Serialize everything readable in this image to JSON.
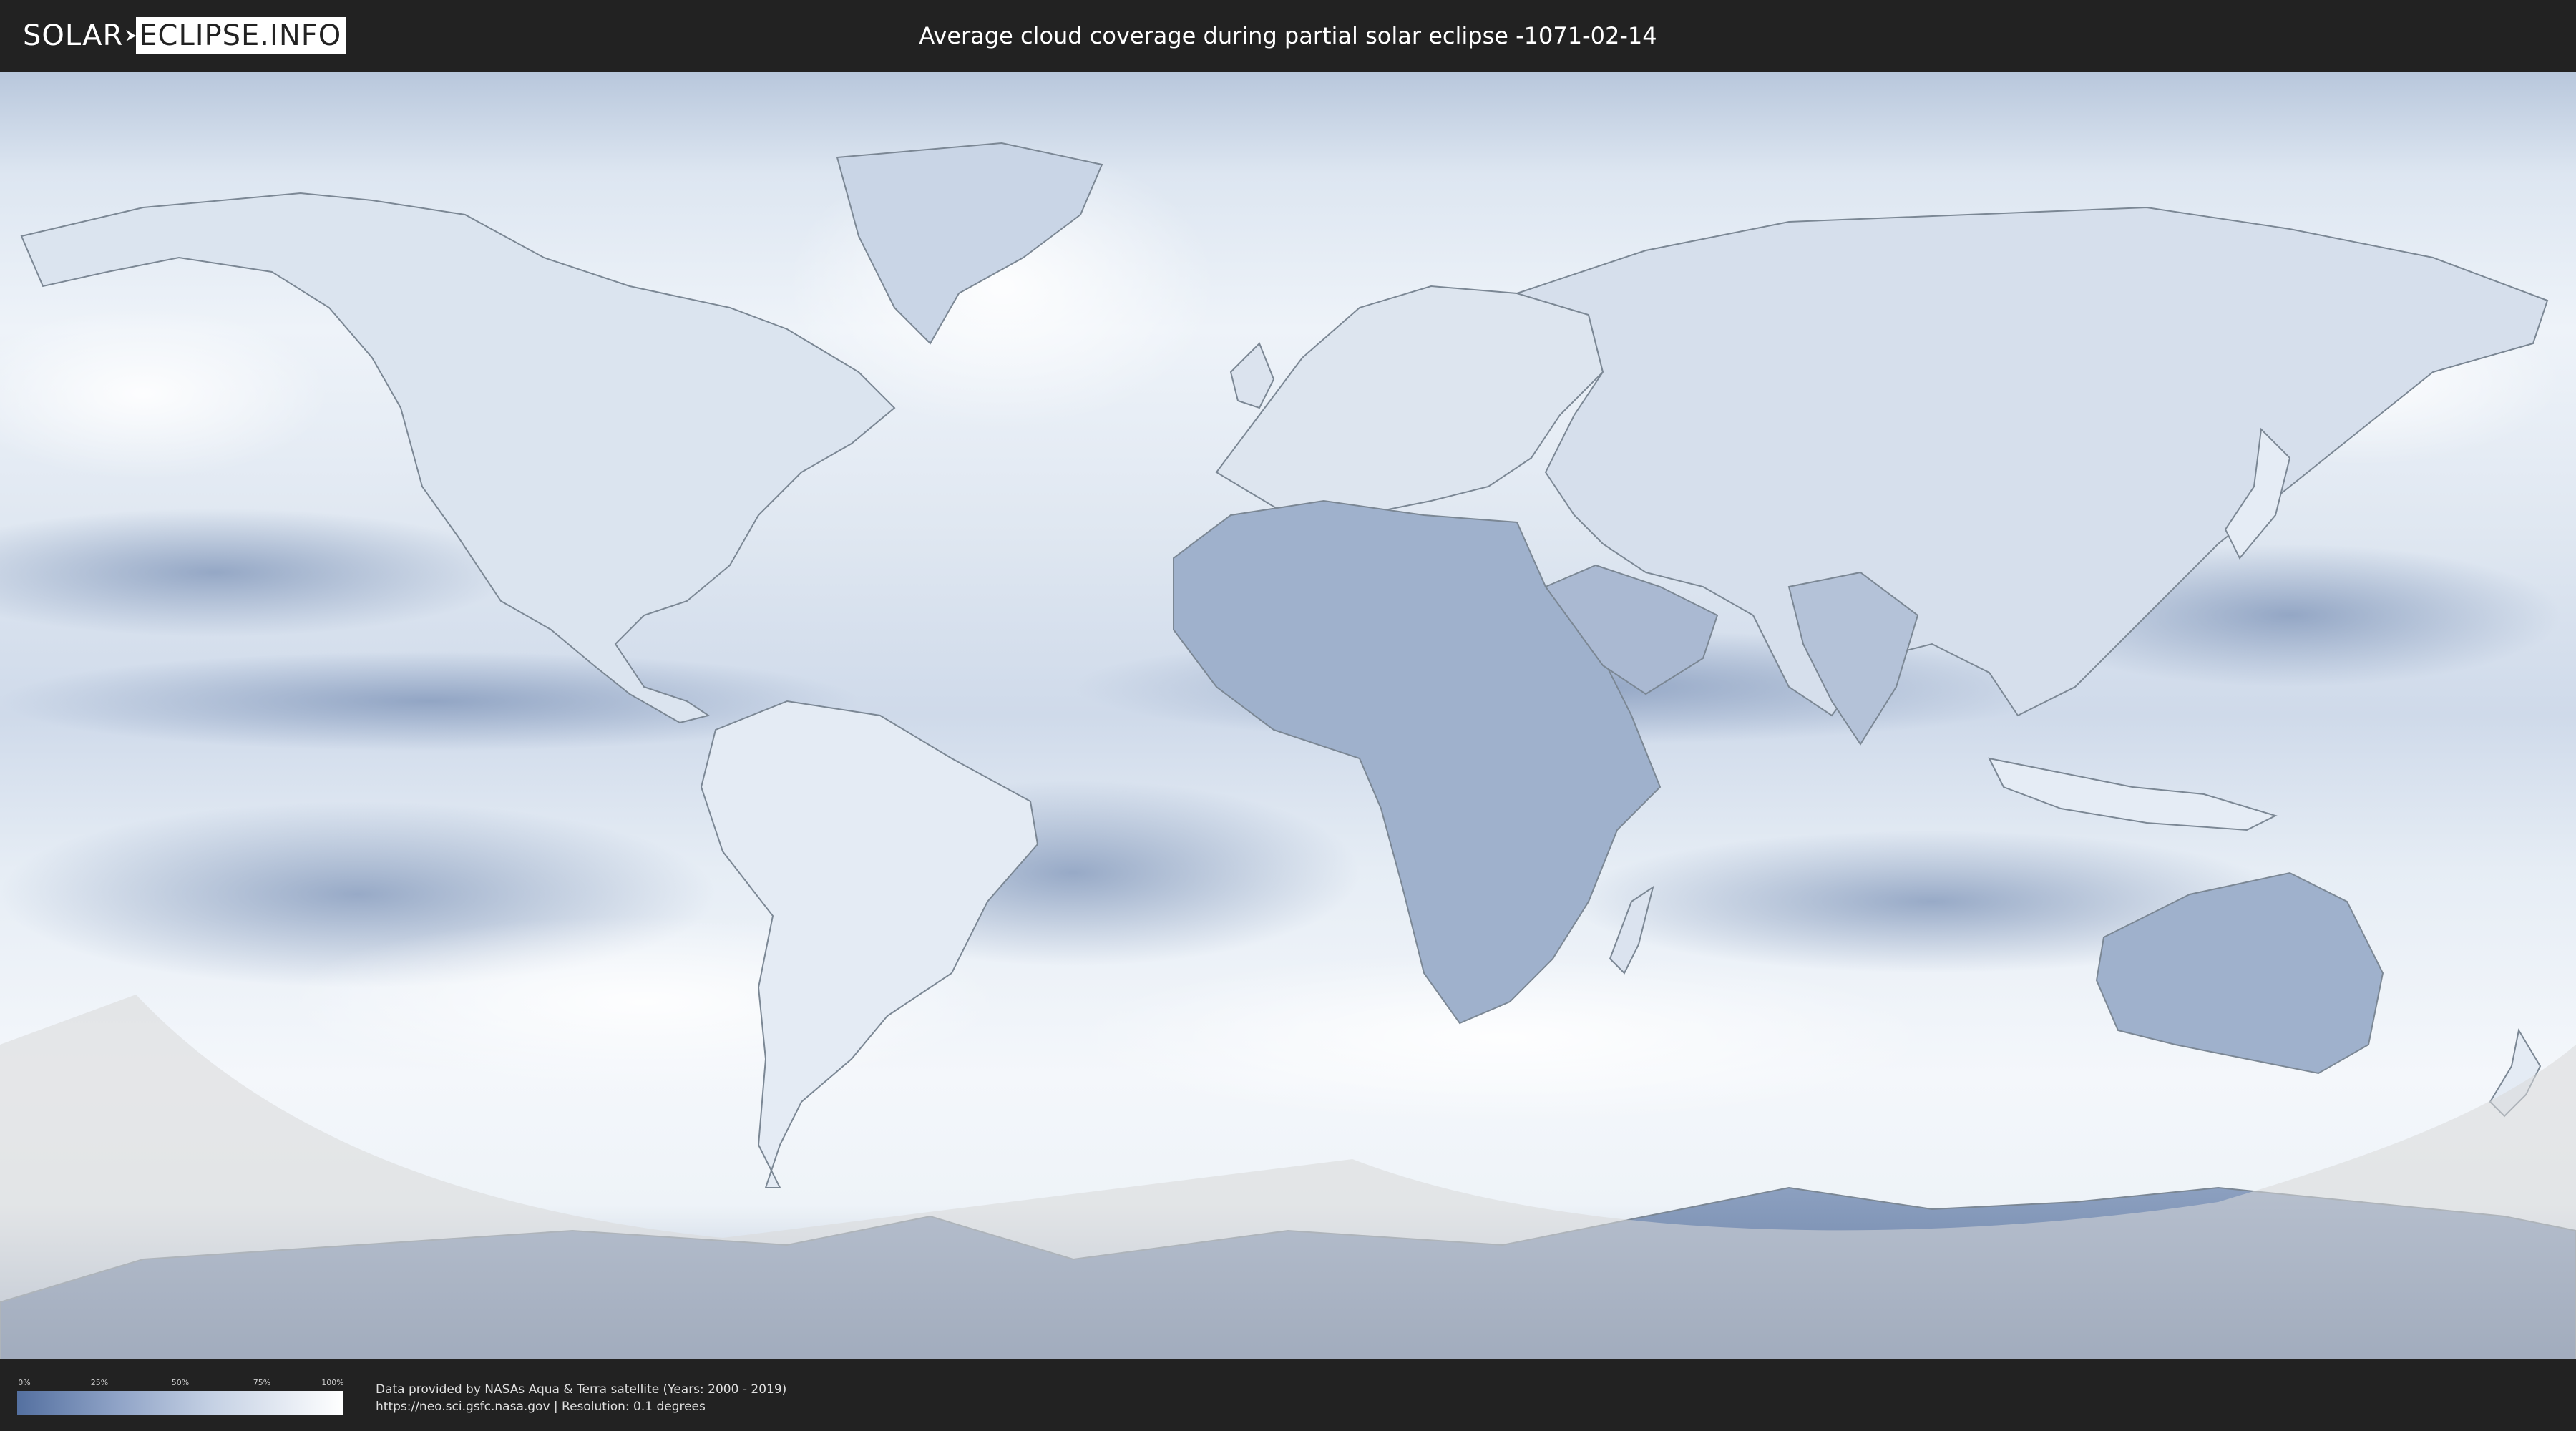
{
  "header": {
    "logo_left": "SOLAR",
    "logo_right": "ECLIPSE.INFO",
    "title": "Average cloud coverage during partial solar eclipse -1071-02-14"
  },
  "map": {
    "projection": "equirectangular",
    "land_outline_color": "#7b8794",
    "ocean_light_color": "#f2f6fb",
    "cloud_dark_color": "#6f86ad",
    "shadow_overlay_color": "#d8d8d8"
  },
  "legend": {
    "ticks": [
      "0%",
      "25%",
      "50%",
      "75%",
      "100%"
    ],
    "gradient_start_color": "#5470a0",
    "gradient_end_color": "#ffffff"
  },
  "credits": {
    "line1": "Data provided by NASAs Aqua & Terra satellite (Years: 2000 - 2019)",
    "line2": "https://neo.sci.gsfc.nasa.gov | Resolution: 0.1 degrees"
  },
  "icons": [
    "solar-eclipse-logo"
  ]
}
